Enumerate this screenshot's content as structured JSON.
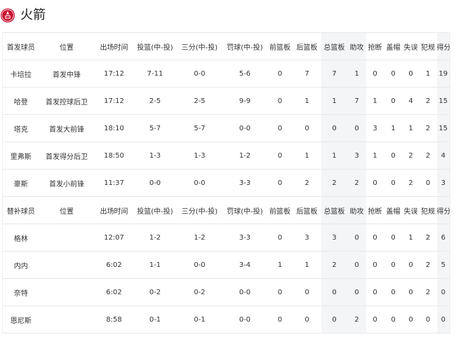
{
  "team": {
    "name": "火箭",
    "logo_icon": "rockets-logo-icon",
    "logo_color": "#c8102e"
  },
  "highlight_color": "#f4f5f7",
  "starters": {
    "headers": [
      "首发球员",
      "位置",
      "出场时间",
      "投篮(中-投)",
      "三分(中-投)",
      "罚球(中-投)",
      "前篮板",
      "后篮板",
      "总篮板",
      "助攻",
      "抢断",
      "盖帽",
      "失误",
      "犯规",
      "得分"
    ],
    "rows": [
      [
        "卡培拉",
        "首发中锋",
        "17:12",
        "7-11",
        "0-0",
        "5-6",
        "0",
        "7",
        "7",
        "1",
        "0",
        "0",
        "0",
        "1",
        "19"
      ],
      [
        "哈登",
        "首发控球后卫",
        "17:12",
        "2-5",
        "2-5",
        "9-9",
        "0",
        "1",
        "1",
        "7",
        "1",
        "0",
        "4",
        "2",
        "15"
      ],
      [
        "塔克",
        "首发大前锋",
        "18:10",
        "5-7",
        "5-7",
        "0-0",
        "0",
        "0",
        "0",
        "0",
        "3",
        "1",
        "1",
        "2",
        "15"
      ],
      [
        "里弗斯",
        "首发得分后卫",
        "18:50",
        "1-3",
        "1-3",
        "1-2",
        "0",
        "1",
        "1",
        "3",
        "1",
        "0",
        "2",
        "2",
        "4"
      ],
      [
        "豪斯",
        "首发小前锋",
        "11:37",
        "0-0",
        "0-0",
        "3-3",
        "0",
        "2",
        "2",
        "2",
        "0",
        "0",
        "2",
        "0",
        "3"
      ]
    ]
  },
  "bench": {
    "headers": [
      "替补球员",
      "位置",
      "出场时间",
      "投篮(中-投)",
      "三分(中-投)",
      "罚球(中-投)",
      "前篮板",
      "后篮板",
      "总篮板",
      "助攻",
      "抢断",
      "盖帽",
      "失误",
      "犯规",
      "得分"
    ],
    "rows": [
      [
        "格林",
        "",
        "12:07",
        "1-2",
        "1-2",
        "3-3",
        "0",
        "3",
        "3",
        "0",
        "0",
        "0",
        "1",
        "2",
        "6"
      ],
      [
        "内内",
        "",
        "6:02",
        "1-1",
        "0-0",
        "3-4",
        "1",
        "1",
        "2",
        "0",
        "0",
        "0",
        "0",
        "2",
        "5"
      ],
      [
        "奈特",
        "",
        "6:02",
        "0-2",
        "0-2",
        "0-0",
        "0",
        "0",
        "0",
        "0",
        "0",
        "0",
        "0",
        "2",
        "0"
      ],
      [
        "恩尼斯",
        "",
        "8:58",
        "0-1",
        "0-1",
        "0-0",
        "0",
        "0",
        "0",
        "2",
        "0",
        "0",
        "0",
        "0",
        "0"
      ]
    ]
  }
}
